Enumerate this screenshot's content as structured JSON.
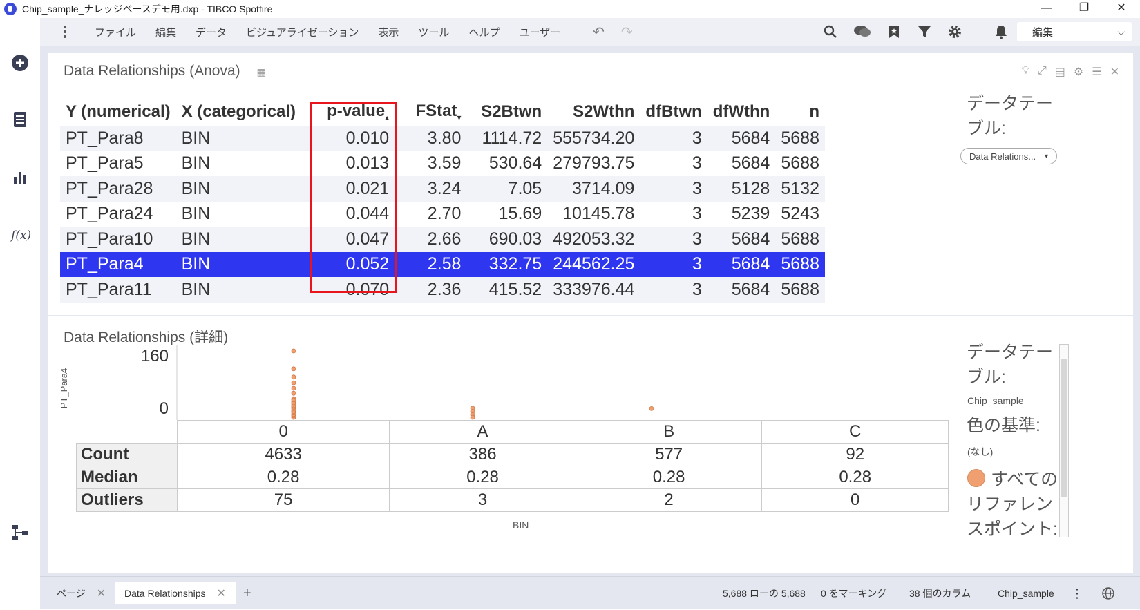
{
  "window": {
    "title": "Chip_sample_ナレッジベースデモ用.dxp - TIBCO Spotfire",
    "minimize": "—",
    "restore": "❐",
    "close": "✕"
  },
  "menu": {
    "items": [
      "ファイル",
      "編集",
      "データ",
      "ビジュアライゼーション",
      "表示",
      "ツール",
      "ヘルプ",
      "ユーザー"
    ],
    "mode_label": "編集"
  },
  "anova": {
    "title": "Data Relationships (Anova)",
    "columns": [
      "Y (numerical)",
      "X (categorical)",
      "p-value",
      "FStat",
      "S2Btwn",
      "S2Wthn",
      "dfBtwn",
      "dfWthn",
      "n"
    ],
    "rows": [
      {
        "y": "PT_Para8",
        "x": "BIN",
        "p": "0.010",
        "f": "3.80",
        "s2b": "1114.72",
        "s2w": "555734.20",
        "dfb": "3",
        "dfw": "5684",
        "n": "5688"
      },
      {
        "y": "PT_Para5",
        "x": "BIN",
        "p": "0.013",
        "f": "3.59",
        "s2b": "530.64",
        "s2w": "279793.75",
        "dfb": "3",
        "dfw": "5684",
        "n": "5688"
      },
      {
        "y": "PT_Para28",
        "x": "BIN",
        "p": "0.021",
        "f": "3.24",
        "s2b": "7.05",
        "s2w": "3714.09",
        "dfb": "3",
        "dfw": "5128",
        "n": "5132"
      },
      {
        "y": "PT_Para24",
        "x": "BIN",
        "p": "0.044",
        "f": "2.70",
        "s2b": "15.69",
        "s2w": "10145.78",
        "dfb": "3",
        "dfw": "5239",
        "n": "5243"
      },
      {
        "y": "PT_Para10",
        "x": "BIN",
        "p": "0.047",
        "f": "2.66",
        "s2b": "690.03",
        "s2w": "492053.32",
        "dfb": "3",
        "dfw": "5684",
        "n": "5688"
      },
      {
        "y": "PT_Para4",
        "x": "BIN",
        "p": "0.052",
        "f": "2.58",
        "s2b": "332.75",
        "s2w": "244562.25",
        "dfb": "3",
        "dfw": "5684",
        "n": "5688"
      },
      {
        "y": "PT_Para11",
        "x": "BIN",
        "p": "0.070",
        "f": "2.36",
        "s2b": "415.52",
        "s2w": "333976.44",
        "dfb": "3",
        "dfw": "5684",
        "n": "5688"
      }
    ],
    "selected_row": 5,
    "side_label": "データテーブル:",
    "table_select": "Data Relations..."
  },
  "detail": {
    "title": "Data Relationships (詳細)",
    "side_table_label": "データテーブル:",
    "side_table_value": "Chip_sample",
    "color_by_label": "色の基準:",
    "color_by_value": "(なし)",
    "legend_item": "すべての...",
    "reference_label": "リファレンスポイント:",
    "stats": {
      "row_labels": [
        "Count",
        "Median",
        "Outliers"
      ],
      "values": [
        [
          "4633",
          "386",
          "577",
          "92"
        ],
        [
          "0.28",
          "0.28",
          "0.28",
          "0.28"
        ],
        [
          "75",
          "3",
          "2",
          "0"
        ]
      ]
    }
  },
  "chart_data": {
    "type": "scatter",
    "categories": [
      "0",
      "A",
      "B",
      "C"
    ],
    "xlabel": "BIN",
    "ylabel": "PT_Para4",
    "y_ticks": [
      "160",
      "0"
    ],
    "ylim": [
      0,
      160
    ],
    "series": [
      {
        "category": "0",
        "values": [
          160,
          117,
          97,
          83,
          70,
          58,
          45,
          35,
          25,
          15,
          5,
          0
        ]
      },
      {
        "category": "A",
        "values": [
          22,
          14,
          6,
          0
        ]
      },
      {
        "category": "B",
        "values": [
          21
        ]
      },
      {
        "category": "C",
        "values": []
      }
    ],
    "point_color": "#f0a070"
  },
  "status": {
    "tabs": [
      {
        "label": "ページ",
        "active": false
      },
      {
        "label": "Data Relationships",
        "active": true
      }
    ],
    "add_tab": "+",
    "rows_info": "5,688 ローの 5,688",
    "marked_info": "0 をマーキング",
    "columns_info": "38 個のカラム",
    "table_name": "Chip_sample"
  }
}
